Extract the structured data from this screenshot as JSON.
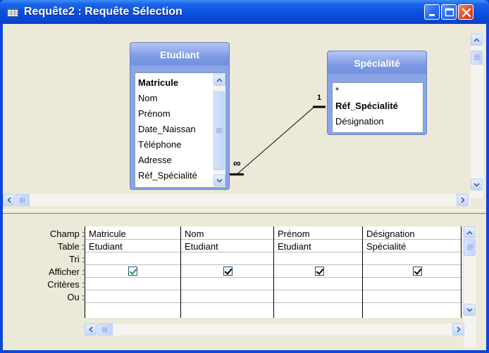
{
  "window": {
    "title": "Requête2 : Requête Sélection",
    "icon": "query-icon"
  },
  "tables": {
    "etudiant": {
      "title": "Etudiant",
      "fields": [
        "Matricule",
        "Nom",
        "Prénom",
        "Date_Naissan",
        "Téléphone",
        "Adresse",
        "Réf_Spécialité"
      ]
    },
    "specialite": {
      "title": "Spécialité",
      "fields": [
        "*",
        "Réf_Spécialité",
        "Désignation"
      ]
    }
  },
  "relationship": {
    "one_label": "1",
    "many_label": "∞"
  },
  "grid": {
    "row_labels": [
      "Champ :",
      "Table :",
      "Tri :",
      "Afficher :",
      "Critères :",
      "Ou :"
    ],
    "columns": [
      {
        "champ": "Matricule",
        "table": "Etudiant",
        "tri": "",
        "afficher": true
      },
      {
        "champ": "Nom",
        "table": "Etudiant",
        "tri": "",
        "afficher": true
      },
      {
        "champ": "Prénom",
        "table": "Etudiant",
        "tri": "",
        "afficher": true
      },
      {
        "champ": "Désignation",
        "table": "Spécialité",
        "tri": "",
        "afficher": true
      }
    ]
  },
  "colors": {
    "titlebar": "#0a4fe0",
    "table_header": "#7e9ae4",
    "client": "#ece9d8"
  }
}
